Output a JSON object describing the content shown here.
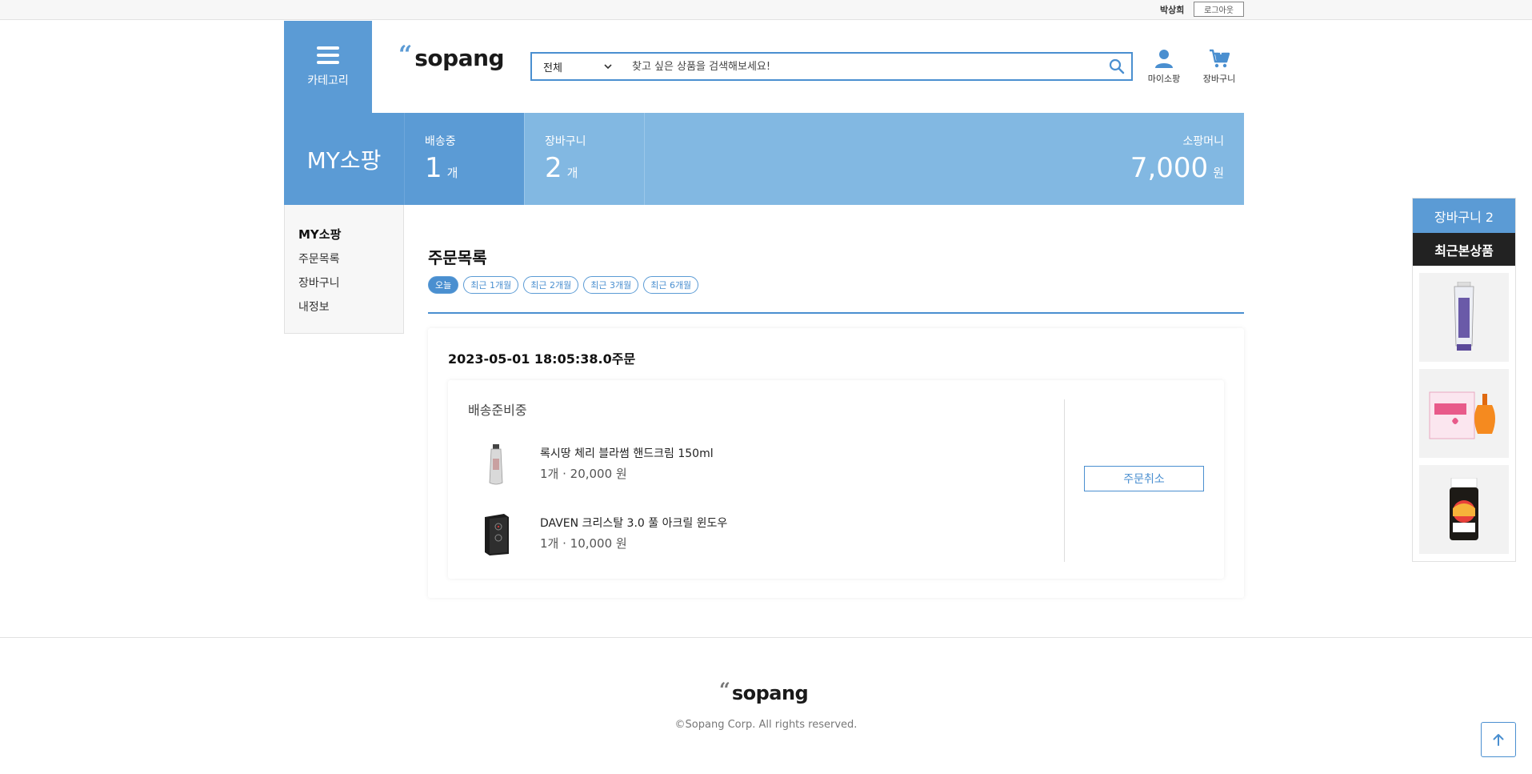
{
  "topbar": {
    "user_name": "박상희",
    "logout_label": "로그아웃"
  },
  "header": {
    "category_label": "카테고리",
    "logo_text": "sopang",
    "search": {
      "scope": "전체",
      "placeholder": "찾고 싶은 상품을 검색해보세요!"
    },
    "mypage_label": "마이소팡",
    "cart_label": "장바구니"
  },
  "banner": {
    "title": "MY소팡",
    "shipping_label": "배송중",
    "shipping_count": "1",
    "shipping_unit": "개",
    "cart_label": "장바구니",
    "cart_count": "2",
    "cart_unit": "개",
    "money_label": "소팡머니",
    "money_value": "7,000",
    "money_unit": "원"
  },
  "sidenav": {
    "heading": "MY소팡",
    "items": [
      "주문목록",
      "장바구니",
      "내정보"
    ]
  },
  "orders": {
    "title": "주문목록",
    "filters": [
      "오늘",
      "최근 1개월",
      "최근 2개월",
      "최근 3개월",
      "최근 6개월"
    ],
    "active_filter": "오늘",
    "list": [
      {
        "date": "2023-05-01 18:05:38.0주문",
        "status": "배송준비중",
        "items": [
          {
            "name": "록시땅 체리 블라썸 핸드크림 150ml",
            "qty_price": "1개 · 20,000 원"
          },
          {
            "name": "DAVEN 크리스탈 3.0 풀 아크릴 윈도우",
            "qty_price": "1개 · 10,000 원"
          }
        ],
        "cancel_label": "주문취소"
      }
    ]
  },
  "right_sidebar": {
    "cart_label": "장바구니 2",
    "recent_label": "최근본상품"
  },
  "footer": {
    "logo_text": "sopang",
    "copyright": "©Sopang Corp. All rights reserved."
  },
  "colors": {
    "primary": "#5b9bd5",
    "primary_light": "#82b8e2",
    "accent": "#4a8fd0",
    "dark": "#222222"
  }
}
